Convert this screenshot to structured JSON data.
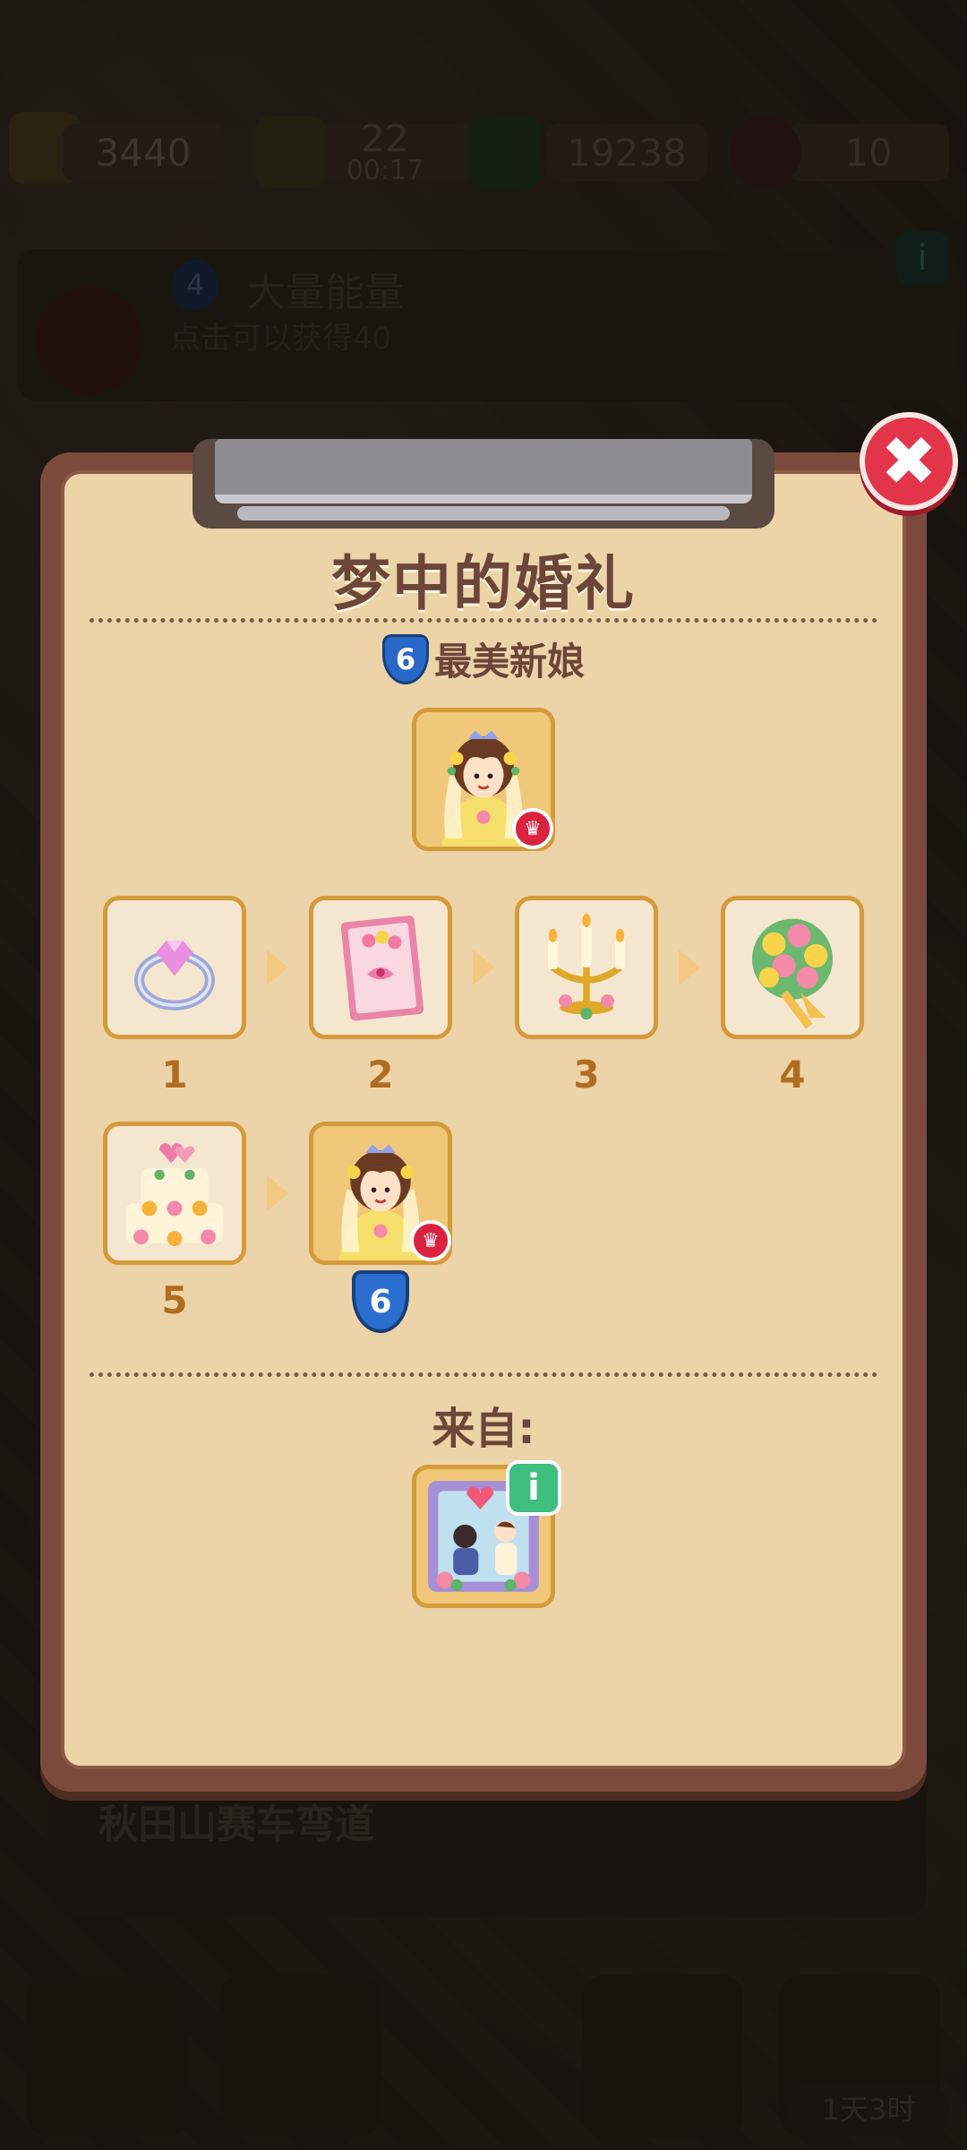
{
  "background": {
    "coins": "3440",
    "energy": "22",
    "energy_timer": "00:17",
    "cash": "19238",
    "gems": "10",
    "quest_level": "4",
    "quest_title": "大量能量",
    "quest_desc": "点击可以获得40",
    "bottom_title": "秋田山赛车弯道",
    "timer": "1天3时"
  },
  "dialog": {
    "title": "梦中的婚礼",
    "target_level": "6",
    "target_name": "最美新娘",
    "chain": [
      {
        "num": "1",
        "icon": "ring-icon"
      },
      {
        "num": "2",
        "icon": "invitation-card-icon"
      },
      {
        "num": "3",
        "icon": "candelabra-icon"
      },
      {
        "num": "4",
        "icon": "bouquet-icon"
      },
      {
        "num": "5",
        "icon": "wedding-cake-icon"
      },
      {
        "num": "6",
        "icon": "bride-icon"
      }
    ],
    "from_label": "来自:",
    "source_icon": "proposal-photo-icon",
    "close_icon": "close-icon",
    "info_icon": "info-icon",
    "info_glyph": "i",
    "close_glyph": "✖",
    "crown_glyph": "♛"
  },
  "colors": {
    "panel": "#ecd3a8",
    "frame": "#7b4a3c",
    "tile_border": "#d49a3b",
    "number": "#b06d22",
    "close": "#e2354a",
    "shield": "#2868c8"
  }
}
